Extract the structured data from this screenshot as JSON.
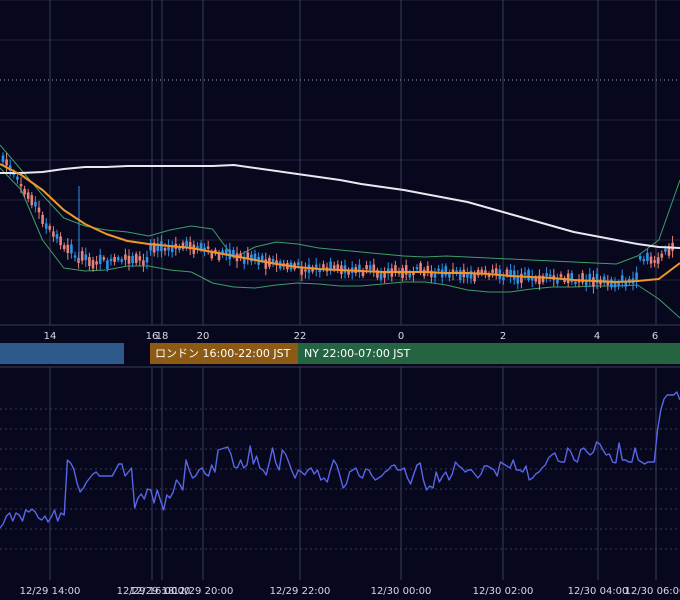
{
  "colors": {
    "background": "#07071e",
    "grid": "#3a3c55",
    "candle_up": "#2b93e8",
    "candle_down": "#e8837a",
    "ma_long": "#e8e8f0",
    "ma_short": "#f0962a",
    "bollinger": "#3f9e66",
    "oscillator": "#5866e8",
    "session_tokyo": "#2d5a8a",
    "session_london": "#8c5a14",
    "session_ny": "#246440",
    "axis_text": "#d8d8e8"
  },
  "sessions": {
    "london": "ロンドン 16:00-22:00 JST",
    "ny": "NY 22:00-07:00 JST"
  },
  "chart_data": [
    {
      "type": "candlestick",
      "title": "",
      "x_tick_labels": [
        "14",
        "16",
        "18",
        "20",
        "22",
        "0",
        "2",
        "4",
        "6"
      ],
      "grid": true,
      "overlays": [
        "long moving average",
        "short moving average",
        "bollinger bands"
      ],
      "candles": [],
      "ma_long": [
        173,
        173,
        172,
        169,
        167,
        167,
        166,
        166,
        166,
        166,
        166,
        165,
        168,
        171,
        174,
        177,
        180,
        184,
        187,
        190,
        194,
        198,
        202,
        208,
        214,
        220,
        226,
        232,
        236,
        240,
        244,
        247,
        248
      ],
      "ma_short": [
        164,
        175,
        190,
        210,
        224,
        234,
        241,
        244,
        246,
        248,
        252,
        256,
        260,
        264,
        267,
        269,
        270,
        271,
        272,
        272,
        272,
        273,
        273,
        274,
        276,
        277,
        278,
        280,
        281,
        282,
        281,
        279,
        263
      ],
      "bb_upper": [
        145,
        170,
        195,
        218,
        226,
        230,
        232,
        236,
        230,
        226,
        229,
        258,
        247,
        242,
        244,
        248,
        250,
        252,
        254,
        256,
        257,
        256,
        257,
        258,
        259,
        260,
        261,
        262,
        263,
        264,
        256,
        240,
        180
      ],
      "bb_lower": [
        168,
        190,
        240,
        268,
        271,
        270,
        266,
        266,
        270,
        272,
        283,
        287,
        288,
        285,
        283,
        284,
        286,
        286,
        284,
        282,
        282,
        285,
        290,
        292,
        292,
        289,
        287,
        287,
        286,
        286,
        285,
        299,
        318
      ]
    },
    {
      "type": "line",
      "title": "",
      "x_tick_labels": [
        "12/29 14:00",
        "12/29 16:00",
        "12/29 18:00",
        "12/29 20:00",
        "12/29 22:00",
        "12/30 00:00",
        "12/30 02:00",
        "12/30 04:00",
        "12/30 06:00"
      ],
      "grid": true,
      "series": [
        {
          "values": [
            528,
            524,
            516,
            513,
            521,
            513,
            515,
            521,
            510,
            512,
            509,
            512,
            518,
            520,
            516,
            522,
            517,
            510,
            521,
            513,
            515,
            460,
            463,
            469,
            483,
            492,
            488,
            482,
            478,
            474,
            472,
            476,
            476,
            476,
            476,
            476,
            470,
            464,
            464,
            476,
            472,
            468,
            508,
            498,
            494,
            499,
            489,
            490,
            503,
            490,
            500,
            510,
            495,
            498,
            492,
            480,
            484,
            490,
            460,
            470,
            478,
            476,
            470,
            468,
            474,
            476,
            465,
            472,
            450,
            449,
            448,
            447,
            454,
            467,
            468,
            460,
            468,
            465,
            446,
            464,
            456,
            468,
            470,
            475,
            462,
            448,
            463,
            470,
            450,
            454,
            462,
            471,
            478,
            470,
            472,
            475,
            470,
            468,
            474,
            470,
            480,
            478,
            482,
            470,
            460,
            465,
            476,
            488,
            484,
            472,
            470,
            468,
            476,
            478,
            469,
            470,
            476,
            480,
            478,
            476,
            472,
            470,
            466,
            465,
            470,
            470,
            468,
            478,
            484,
            474,
            465,
            463,
            480,
            490,
            486,
            488,
            472,
            482,
            476,
            472,
            480,
            474,
            462,
            466,
            468,
            472,
            470,
            470,
            474,
            478,
            474,
            466,
            466,
            468,
            470,
            476,
            462,
            464,
            466,
            468,
            460,
            470,
            470,
            472,
            466,
            480,
            478,
            474,
            472,
            468,
            465,
            458,
            455,
            453,
            461,
            462,
            462,
            448,
            452,
            460,
            462,
            450,
            448,
            452,
            455,
            452,
            442,
            444,
            450,
            455,
            454,
            462,
            463,
            443,
            460,
            460,
            462,
            462,
            448,
            460,
            462,
            464,
            462,
            462,
            462,
            430,
            410,
            399,
            395,
            395,
            395,
            392,
            400
          ]
        }
      ]
    }
  ]
}
